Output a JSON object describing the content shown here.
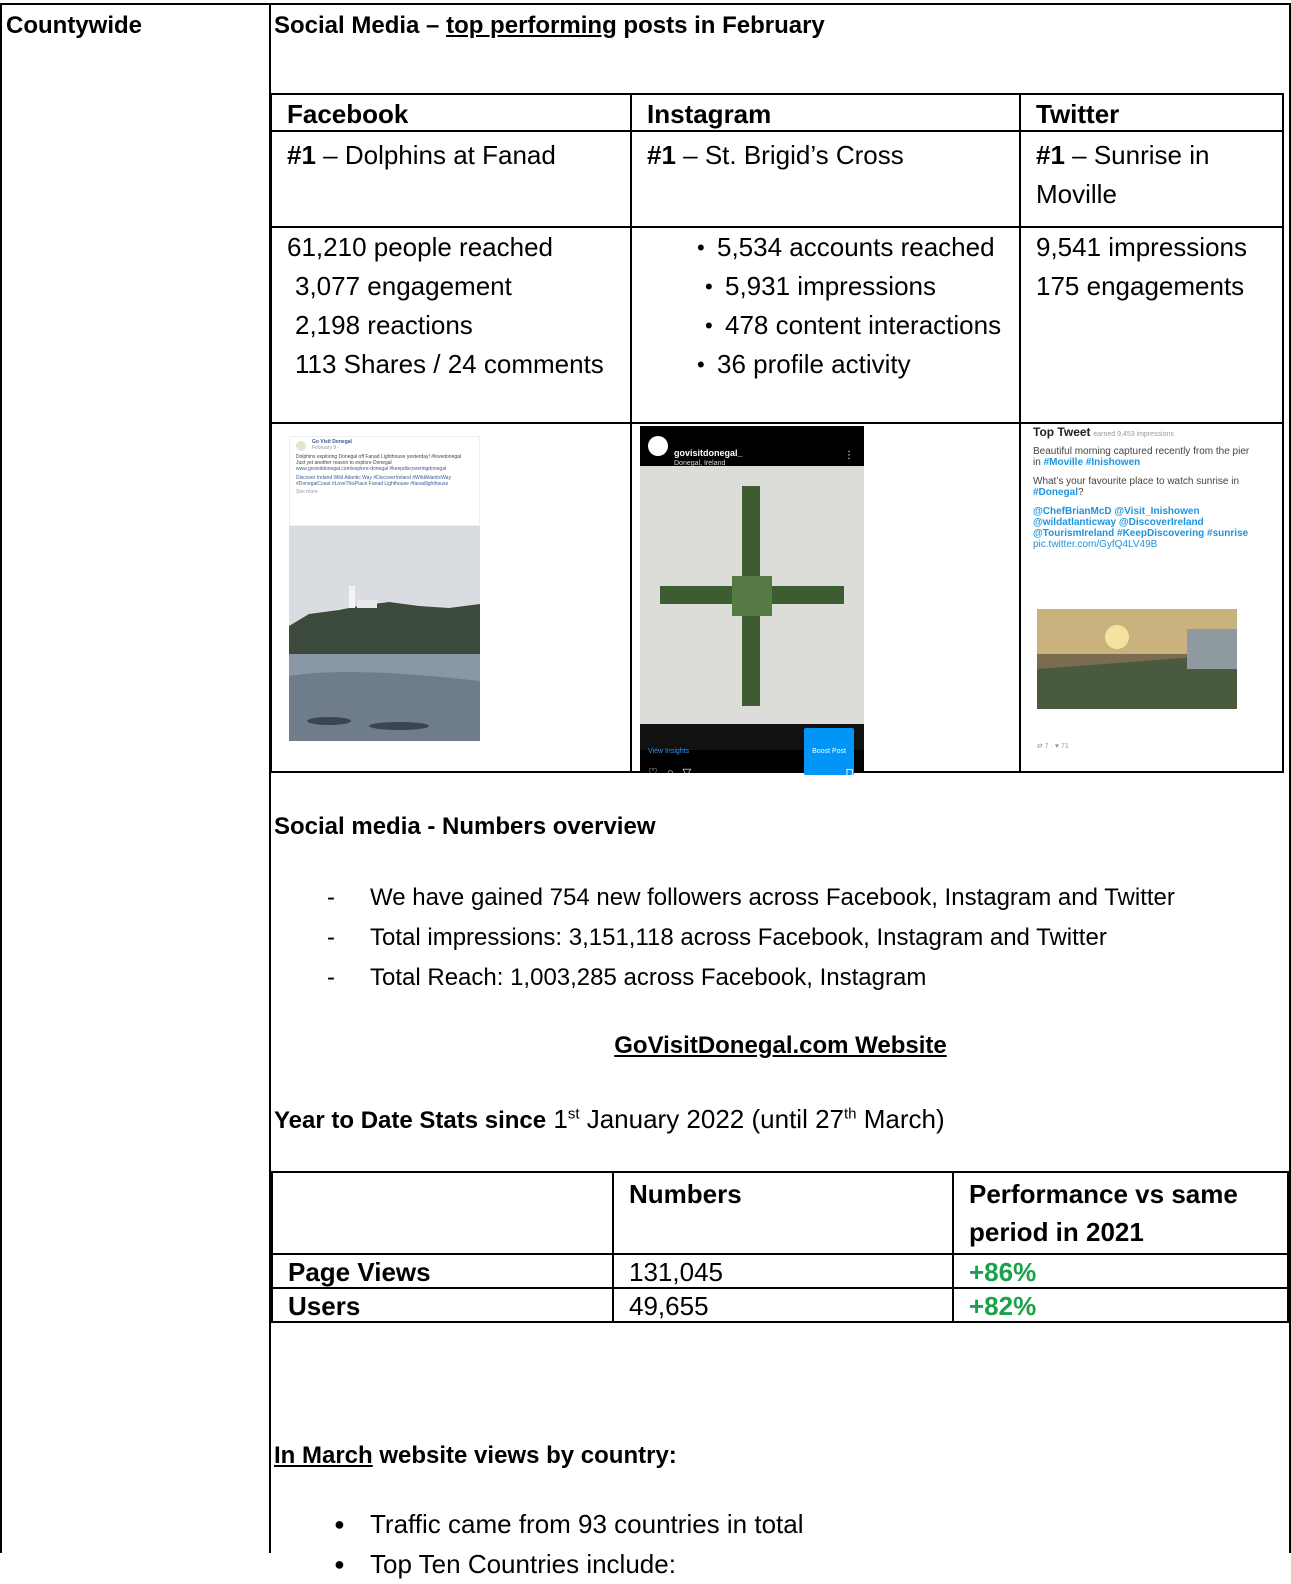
{
  "left_label": "Countywide",
  "social": {
    "title_prefix": "Social Media – ",
    "title_underlined": "top performing",
    "title_suffix": " posts in February",
    "columns": [
      "Facebook",
      "Instagram",
      "Twitter"
    ],
    "facebook": {
      "rank": "#1",
      "post": " – Dolphins at Fanad",
      "stats": [
        "61,210 people reached",
        "3,077 engagement",
        "2,198 reactions",
        "113 Shares / 24 comments"
      ],
      "screenshot": {
        "page_name": "Go Visit Donegal",
        "date": "February 9 ·",
        "text": "Dolphins exploring Donegal off Fanad Lighthouse yesterday! #lovedonegal",
        "text2": "Just yet another reason to explore Donegal",
        "link": "www.govisitdonegal.com/explore-donegal #keepdiscoveringdonegal",
        "tags": "Discover Ireland Wild Atlantic Way #DiscoverIreland #WildAtlanticWay #DonegalCoast #LoveThisPlace Fanad Lighthouse #fanadlighthouse",
        "see_more": "See more"
      }
    },
    "instagram": {
      "rank": "#1",
      "post": " – St. Brigid’s Cross",
      "stats": [
        "5,534 accounts reached",
        "5,931 impressions",
        "478 content interactions",
        "36 profile activity"
      ],
      "screenshot": {
        "handle": "govisitdonegal_",
        "location": "Donegal, Ireland",
        "view_insights": "View Insights",
        "boost_post": "Boost Post"
      }
    },
    "twitter": {
      "rank": "#1",
      "post": " – Sunrise in Moville",
      "stats": [
        "9,541 impressions",
        "175 engagements"
      ],
      "screenshot": {
        "label": "Top Tweet",
        "earned": "earned 9,453 impressions",
        "line1": "Beautiful morning captured recently from the pier in ",
        "line1_tags": "#Moville #Inishowen",
        "line2": "What’s your favourite place to watch sunrise in ",
        "line2_tag": "#Donegal",
        "line2_end": "?",
        "mentions": "@ChefBrianMcD @Visit_Inishowen @wildatlanticway @DiscoverIreland @TourismIreland #KeepDiscovering #sunrise",
        "link": "pic.twitter.com/GyfQ4LV49B",
        "footer": "⇄ 7 · ♥ 71"
      }
    }
  },
  "numbers_overview": {
    "title": "Social media - Numbers overview",
    "items": [
      "We have gained 754 new followers across Facebook, Instagram and Twitter",
      "Total impressions: 3,151,118 across Facebook, Instagram and Twitter",
      "Total Reach: 1,003,285 across Facebook, Instagram"
    ]
  },
  "website": {
    "title": "GoVisitDonegal.com Website",
    "ytd_bold": "Year to Date Stats since",
    "ytd_day1": " 1",
    "ytd_sup1": "st",
    "ytd_mid": " January 2022 (until 27",
    "ytd_sup2": "th",
    "ytd_end": " March)",
    "table": {
      "headers": [
        "",
        "Numbers",
        "Performance vs same period in 2021"
      ],
      "rows": [
        {
          "label": "Page Views",
          "number": "131,045",
          "perf": "+86%"
        },
        {
          "label": "Users",
          "number": "49,655",
          "perf": "+82%"
        }
      ]
    }
  },
  "march": {
    "title_underlined": "In March",
    "title_rest": " website views by country:",
    "items": [
      "Traffic came from 93 countries in total",
      "Top Ten Countries include:"
    ]
  }
}
